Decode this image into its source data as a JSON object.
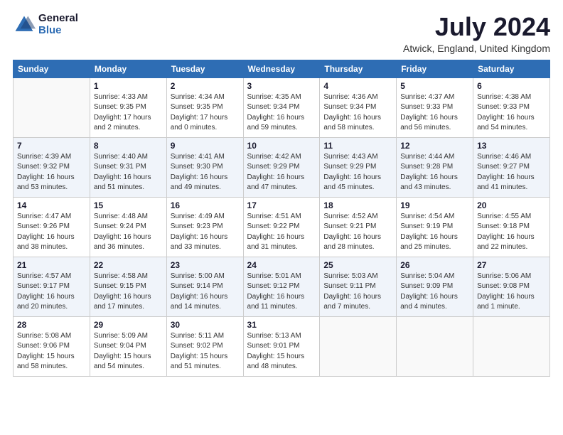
{
  "header": {
    "logo_general": "General",
    "logo_blue": "Blue",
    "title": "July 2024",
    "location": "Atwick, England, United Kingdom"
  },
  "days_of_week": [
    "Sunday",
    "Monday",
    "Tuesday",
    "Wednesday",
    "Thursday",
    "Friday",
    "Saturday"
  ],
  "weeks": [
    [
      {
        "day": "",
        "info": ""
      },
      {
        "day": "1",
        "info": "Sunrise: 4:33 AM\nSunset: 9:35 PM\nDaylight: 17 hours\nand 2 minutes."
      },
      {
        "day": "2",
        "info": "Sunrise: 4:34 AM\nSunset: 9:35 PM\nDaylight: 17 hours\nand 0 minutes."
      },
      {
        "day": "3",
        "info": "Sunrise: 4:35 AM\nSunset: 9:34 PM\nDaylight: 16 hours\nand 59 minutes."
      },
      {
        "day": "4",
        "info": "Sunrise: 4:36 AM\nSunset: 9:34 PM\nDaylight: 16 hours\nand 58 minutes."
      },
      {
        "day": "5",
        "info": "Sunrise: 4:37 AM\nSunset: 9:33 PM\nDaylight: 16 hours\nand 56 minutes."
      },
      {
        "day": "6",
        "info": "Sunrise: 4:38 AM\nSunset: 9:33 PM\nDaylight: 16 hours\nand 54 minutes."
      }
    ],
    [
      {
        "day": "7",
        "info": "Sunrise: 4:39 AM\nSunset: 9:32 PM\nDaylight: 16 hours\nand 53 minutes."
      },
      {
        "day": "8",
        "info": "Sunrise: 4:40 AM\nSunset: 9:31 PM\nDaylight: 16 hours\nand 51 minutes."
      },
      {
        "day": "9",
        "info": "Sunrise: 4:41 AM\nSunset: 9:30 PM\nDaylight: 16 hours\nand 49 minutes."
      },
      {
        "day": "10",
        "info": "Sunrise: 4:42 AM\nSunset: 9:29 PM\nDaylight: 16 hours\nand 47 minutes."
      },
      {
        "day": "11",
        "info": "Sunrise: 4:43 AM\nSunset: 9:29 PM\nDaylight: 16 hours\nand 45 minutes."
      },
      {
        "day": "12",
        "info": "Sunrise: 4:44 AM\nSunset: 9:28 PM\nDaylight: 16 hours\nand 43 minutes."
      },
      {
        "day": "13",
        "info": "Sunrise: 4:46 AM\nSunset: 9:27 PM\nDaylight: 16 hours\nand 41 minutes."
      }
    ],
    [
      {
        "day": "14",
        "info": "Sunrise: 4:47 AM\nSunset: 9:26 PM\nDaylight: 16 hours\nand 38 minutes."
      },
      {
        "day": "15",
        "info": "Sunrise: 4:48 AM\nSunset: 9:24 PM\nDaylight: 16 hours\nand 36 minutes."
      },
      {
        "day": "16",
        "info": "Sunrise: 4:49 AM\nSunset: 9:23 PM\nDaylight: 16 hours\nand 33 minutes."
      },
      {
        "day": "17",
        "info": "Sunrise: 4:51 AM\nSunset: 9:22 PM\nDaylight: 16 hours\nand 31 minutes."
      },
      {
        "day": "18",
        "info": "Sunrise: 4:52 AM\nSunset: 9:21 PM\nDaylight: 16 hours\nand 28 minutes."
      },
      {
        "day": "19",
        "info": "Sunrise: 4:54 AM\nSunset: 9:19 PM\nDaylight: 16 hours\nand 25 minutes."
      },
      {
        "day": "20",
        "info": "Sunrise: 4:55 AM\nSunset: 9:18 PM\nDaylight: 16 hours\nand 22 minutes."
      }
    ],
    [
      {
        "day": "21",
        "info": "Sunrise: 4:57 AM\nSunset: 9:17 PM\nDaylight: 16 hours\nand 20 minutes."
      },
      {
        "day": "22",
        "info": "Sunrise: 4:58 AM\nSunset: 9:15 PM\nDaylight: 16 hours\nand 17 minutes."
      },
      {
        "day": "23",
        "info": "Sunrise: 5:00 AM\nSunset: 9:14 PM\nDaylight: 16 hours\nand 14 minutes."
      },
      {
        "day": "24",
        "info": "Sunrise: 5:01 AM\nSunset: 9:12 PM\nDaylight: 16 hours\nand 11 minutes."
      },
      {
        "day": "25",
        "info": "Sunrise: 5:03 AM\nSunset: 9:11 PM\nDaylight: 16 hours\nand 7 minutes."
      },
      {
        "day": "26",
        "info": "Sunrise: 5:04 AM\nSunset: 9:09 PM\nDaylight: 16 hours\nand 4 minutes."
      },
      {
        "day": "27",
        "info": "Sunrise: 5:06 AM\nSunset: 9:08 PM\nDaylight: 16 hours\nand 1 minute."
      }
    ],
    [
      {
        "day": "28",
        "info": "Sunrise: 5:08 AM\nSunset: 9:06 PM\nDaylight: 15 hours\nand 58 minutes."
      },
      {
        "day": "29",
        "info": "Sunrise: 5:09 AM\nSunset: 9:04 PM\nDaylight: 15 hours\nand 54 minutes."
      },
      {
        "day": "30",
        "info": "Sunrise: 5:11 AM\nSunset: 9:02 PM\nDaylight: 15 hours\nand 51 minutes."
      },
      {
        "day": "31",
        "info": "Sunrise: 5:13 AM\nSunset: 9:01 PM\nDaylight: 15 hours\nand 48 minutes."
      },
      {
        "day": "",
        "info": ""
      },
      {
        "day": "",
        "info": ""
      },
      {
        "day": "",
        "info": ""
      }
    ]
  ]
}
